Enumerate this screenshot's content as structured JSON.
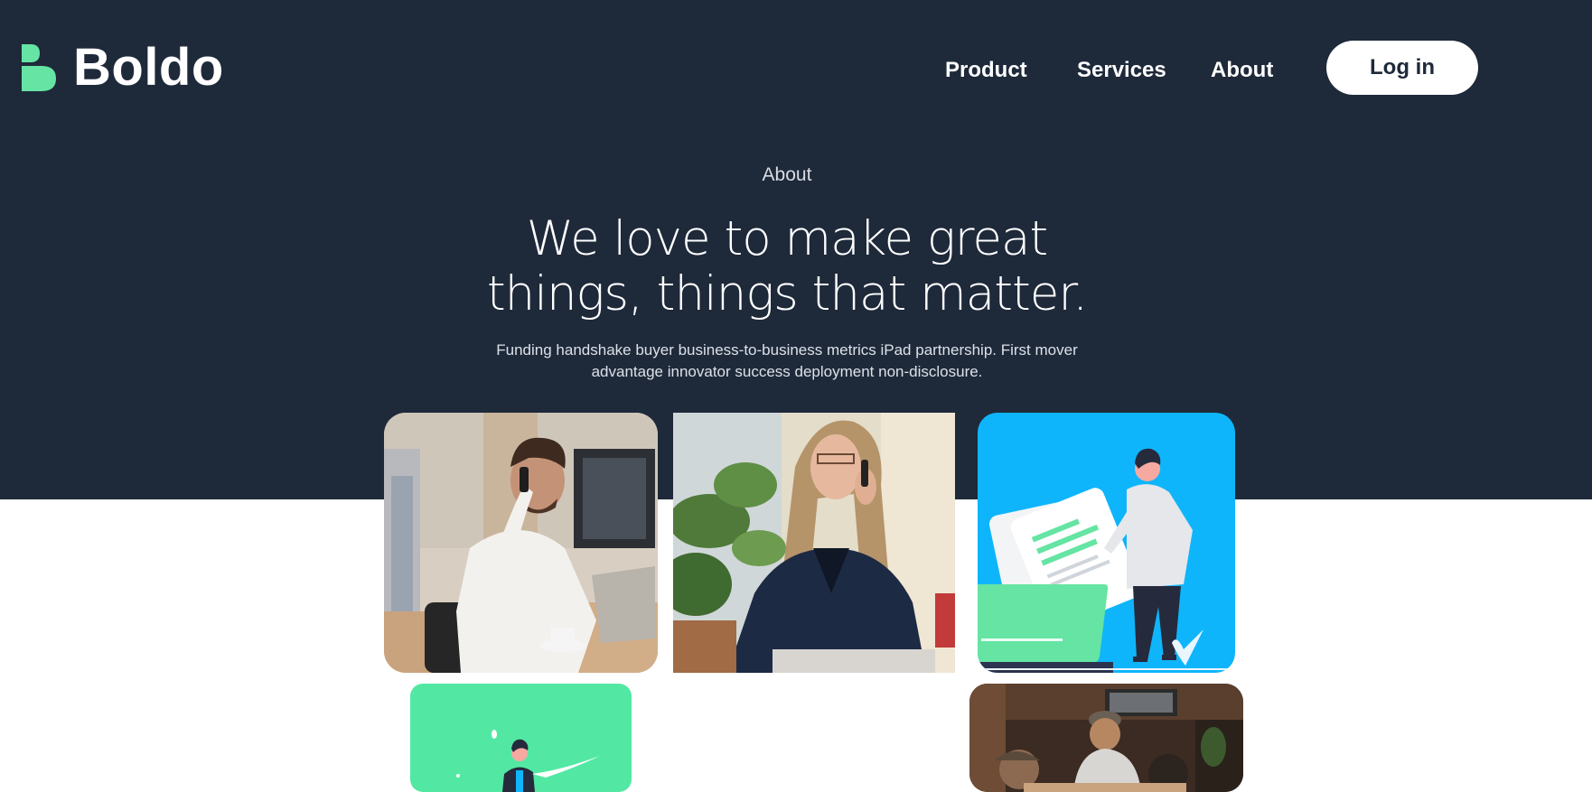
{
  "header": {
    "brand": "Boldo",
    "logo_icon": "boldo-logo-icon",
    "nav": [
      {
        "label": "Product"
      },
      {
        "label": "Services"
      },
      {
        "label": "About"
      }
    ],
    "login_label": "Log in"
  },
  "hero": {
    "eyebrow": "About",
    "headline_line1": "We love to make great",
    "headline_line2": "things, things that matter.",
    "subtext_line1": "Funding handshake buyer business-to-business metrics iPad partnership. First mover",
    "subtext_line2": "advantage innovator success deployment non-disclosure."
  },
  "images": [
    {
      "id": "photo-man-on-phone"
    },
    {
      "id": "photo-woman-on-phone"
    },
    {
      "id": "illustration-person-with-documents"
    },
    {
      "id": "illustration-green-person"
    },
    {
      "id": "photo-team-meeting"
    }
  ],
  "colors": {
    "hero_background": "#1e293a",
    "accent_green": "#65e4a3",
    "accent_blue": "#0fb5fb",
    "page_background": "#ffffff"
  }
}
